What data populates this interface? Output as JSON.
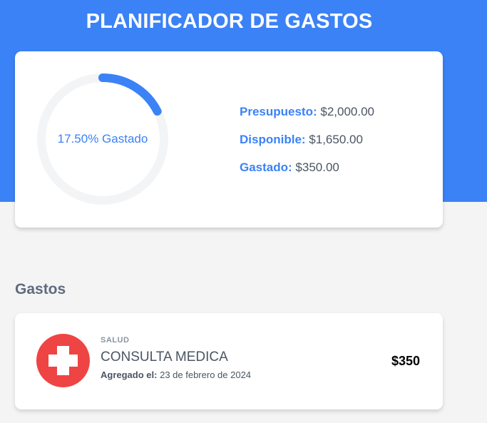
{
  "header": {
    "title": "PLANIFICADOR DE GASTOS"
  },
  "budget": {
    "percent_spent": 17.5,
    "percent_text": "17.50% Gastado",
    "stats": [
      {
        "label": "Presupuesto:",
        "value": "$2,000.00"
      },
      {
        "label": "Disponible:",
        "value": "$1,650.00"
      },
      {
        "label": "Gastado:",
        "value": "$350.00"
      }
    ]
  },
  "expenses": {
    "title": "Gastos",
    "items": [
      {
        "category": "SALUD",
        "name": "CONSULTA MEDICA",
        "date_label": "Agregado el:",
        "date": "23 de febrero de 2024",
        "amount": "$350",
        "icon": "medical-cross-icon"
      }
    ]
  },
  "colors": {
    "accent": "#3b82f6",
    "track": "#f3f4f6",
    "health_icon_bg": "#ef4444"
  }
}
